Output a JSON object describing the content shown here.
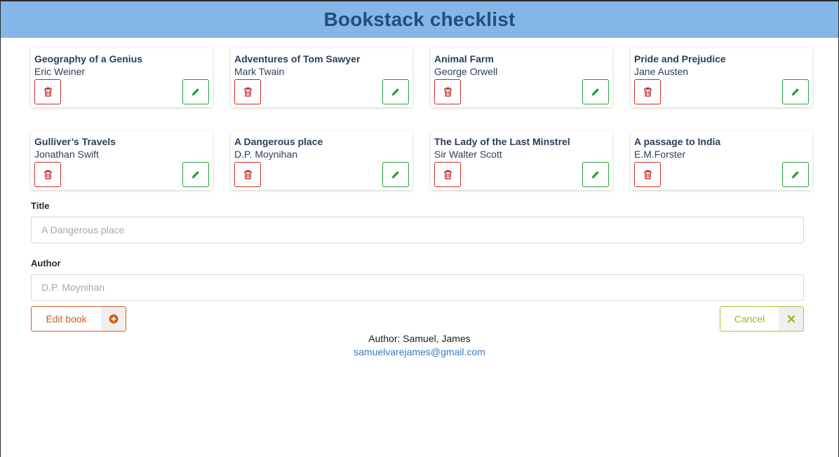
{
  "header": {
    "title": "Bookstack checklist"
  },
  "books": [
    {
      "title": "Geography of a Genius",
      "author": "Eric Weiner"
    },
    {
      "title": "Adventures of Tom Sawyer",
      "author": "Mark Twain"
    },
    {
      "title": "Animal Farm",
      "author": "George Orwell"
    },
    {
      "title": "Pride and Prejudice",
      "author": "Jane Austen"
    },
    {
      "title": "Gulliver’s Travels",
      "author": "Jonathan Swift"
    },
    {
      "title": "A Dangerous place",
      "author": "D.P. Moynihan"
    },
    {
      "title": "The Lady of the Last Minstrel",
      "author": "Sir Walter Scott"
    },
    {
      "title": "A passage to India",
      "author": "E.M.Forster"
    }
  ],
  "form": {
    "title_label": "Title",
    "title_placeholder": "A Dangerous place",
    "author_label": "Author",
    "author_placeholder": "D.P. Moynihan"
  },
  "actions": {
    "edit_label": "Edit book",
    "cancel_label": "Cancel"
  },
  "footer": {
    "author_line": "Author: Samuel, James",
    "email": "samuelvarejames@gmail.com"
  },
  "icons": {
    "delete": "trash-icon",
    "edit": "pencil-icon",
    "add": "plus-circle-icon",
    "cancel": "close-icon"
  },
  "colors": {
    "header_bg": "#85b6e8",
    "header_text": "#1f4f7a",
    "delete": "#cc2b2b",
    "edit": "#22a33b",
    "edit_book": "#d35f1e",
    "cancel": "#9cb82a",
    "link": "#3a78c2"
  }
}
